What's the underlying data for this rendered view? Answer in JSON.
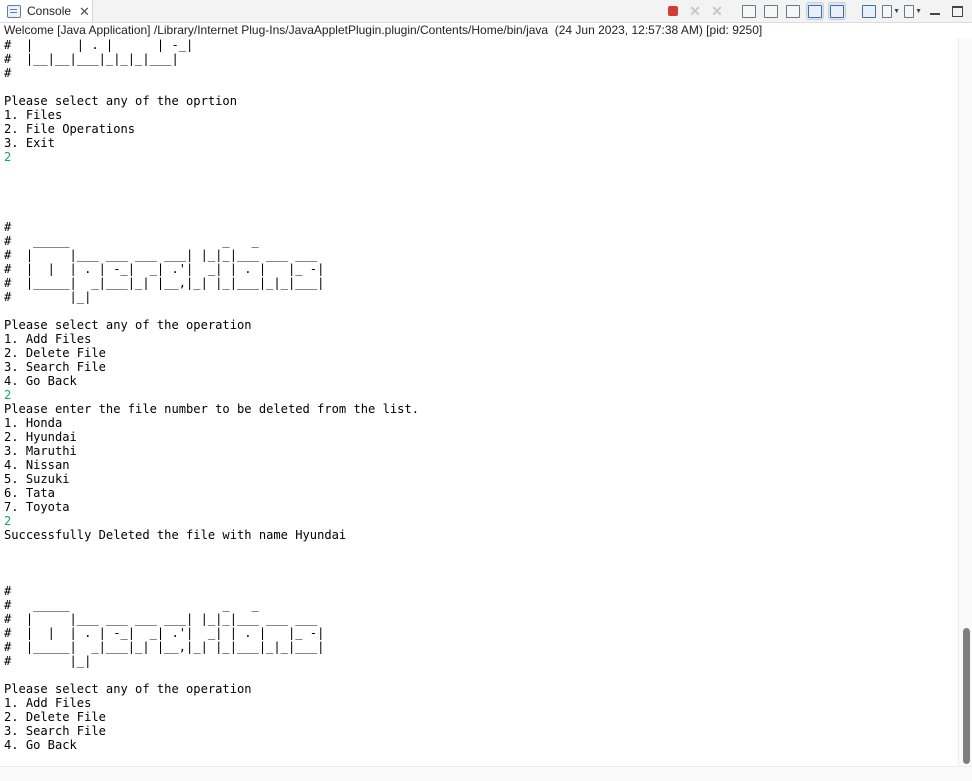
{
  "tab": {
    "label": "Console"
  },
  "status": "Welcome [Java Application] /Library/Internet Plug-Ins/JavaAppletPlugin.plugin/Contents/Home/bin/java  (24 Jun 2023, 12:57:38 AM) [pid: 9250]",
  "toolbar_icons": [
    "terminate-icon",
    "remove-launch-icon",
    "remove-all-terminated-icon",
    "clear-console-icon",
    "scroll-lock-icon",
    "word-wrap-icon",
    "show-on-stdout-icon",
    "show-on-stderr-icon",
    "pin-console-icon",
    "display-console-icon",
    "open-console-icon",
    "minimize-icon",
    "maximize-icon"
  ],
  "colors": {
    "input_text": "#1aa36b",
    "terminate": "#d43b3b"
  },
  "console_lines": [
    {
      "text": "#  |      | . |      | -_|",
      "input": false
    },
    {
      "text": "#  |__|__|___|_|_|_|___|",
      "input": false
    },
    {
      "text": "#",
      "input": false
    },
    {
      "text": "",
      "input": false
    },
    {
      "text": "Please select any of the oprtion",
      "input": false
    },
    {
      "text": "1. Files",
      "input": false
    },
    {
      "text": "2. File Operations",
      "input": false
    },
    {
      "text": "3. Exit",
      "input": false
    },
    {
      "text": "2",
      "input": true
    },
    {
      "text": "",
      "input": false
    },
    {
      "text": "",
      "input": false
    },
    {
      "text": "",
      "input": false
    },
    {
      "text": "",
      "input": false
    },
    {
      "text": "#",
      "input": false
    },
    {
      "text": "#   _____                     _   _",
      "input": false
    },
    {
      "text": "#  |     |___ ___ ___ ___| |_|_|___ ___ ___",
      "input": false
    },
    {
      "text": "#  |  |  | . | -_|  _| .'|  _| | . |   |_ -|",
      "input": false
    },
    {
      "text": "#  |_____|  _|___|_| |__,|_| |_|___|_|_|___|",
      "input": false
    },
    {
      "text": "#        |_|",
      "input": false
    },
    {
      "text": "",
      "input": false
    },
    {
      "text": "Please select any of the operation",
      "input": false
    },
    {
      "text": "1. Add Files",
      "input": false
    },
    {
      "text": "2. Delete File",
      "input": false
    },
    {
      "text": "3. Search File",
      "input": false
    },
    {
      "text": "4. Go Back",
      "input": false
    },
    {
      "text": "2",
      "input": true
    },
    {
      "text": "Please enter the file number to be deleted from the list.",
      "input": false
    },
    {
      "text": "1. Honda",
      "input": false
    },
    {
      "text": "2. Hyundai",
      "input": false
    },
    {
      "text": "3. Maruthi",
      "input": false
    },
    {
      "text": "4. Nissan",
      "input": false
    },
    {
      "text": "5. Suzuki",
      "input": false
    },
    {
      "text": "6. Tata",
      "input": false
    },
    {
      "text": "7. Toyota",
      "input": false
    },
    {
      "text": "2",
      "input": true
    },
    {
      "text": "Successfully Deleted the file with name Hyundai",
      "input": false
    },
    {
      "text": "",
      "input": false
    },
    {
      "text": "",
      "input": false
    },
    {
      "text": "",
      "input": false
    },
    {
      "text": "#",
      "input": false
    },
    {
      "text": "#   _____                     _   _",
      "input": false
    },
    {
      "text": "#  |     |___ ___ ___ ___| |_|_|___ ___ ___",
      "input": false
    },
    {
      "text": "#  |  |  | . | -_|  _| .'|  _| | . |   |_ -|",
      "input": false
    },
    {
      "text": "#  |_____|  _|___|_| |__,|_| |_|___|_|_|___|",
      "input": false
    },
    {
      "text": "#        |_|",
      "input": false
    },
    {
      "text": "",
      "input": false
    },
    {
      "text": "Please select any of the operation",
      "input": false
    },
    {
      "text": "1. Add Files",
      "input": false
    },
    {
      "text": "2. Delete File",
      "input": false
    },
    {
      "text": "3. Search File",
      "input": false
    },
    {
      "text": "4. Go Back",
      "input": false
    }
  ]
}
